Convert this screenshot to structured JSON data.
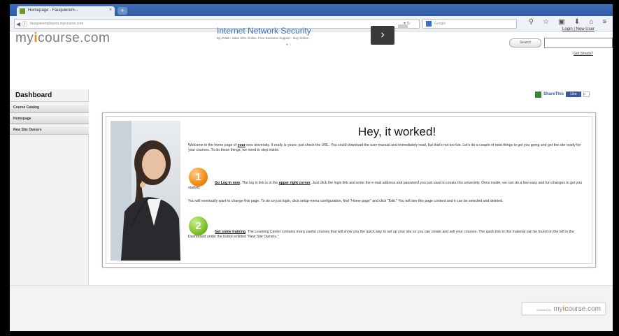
{
  "browser": {
    "tab_title": "Homepage - Fauquierem...",
    "tab_close": "×",
    "tab_new": "+",
    "url": "fauquieremployers.myicourse.com",
    "search_placeholder": "Google",
    "toolbar_icons": [
      "search-icon",
      "star-icon",
      "bookmark-icon",
      "download-icon",
      "home-icon",
      "menu-icon"
    ]
  },
  "header": {
    "logo_prefix": "my",
    "logo_accent": "i",
    "logo_suffix": "course.com",
    "ad": {
      "title": "Internet Network Security",
      "subtitle": "By AV&B - Save 20% Online. Free Business Support - Buy Online",
      "dots": "● ○",
      "arrow": "›"
    },
    "login": "Login",
    "new_user": "New User",
    "search_button": "Search",
    "got_smarts": "Got Smarts?"
  },
  "sidebar": {
    "title": "Dashboard",
    "items": [
      {
        "label": "Course Catalog"
      },
      {
        "label": "Homepage"
      },
      {
        "label": "New Site Owners"
      }
    ]
  },
  "share": {
    "label": "ShareThis",
    "like": "Like",
    "count": "0"
  },
  "main": {
    "heading": "Hey, it worked!",
    "intro_a": "Welcome to the home page of ",
    "intro_b": "your",
    "intro_c": " new university. It really is yours: just check the URL. You could download the user manual and immediately read, but that's not too fun. Let's do a couple of neat things to get you going and get the site ready for your courses. To do these things, we need to step inside.",
    "step1_badge": "1",
    "step1_title": "Go Log in now",
    "step1_a": ". The log in link is in the ",
    "step1_b": "upper right corner",
    "step1_c": ". Just click the login link and enter the e-mail address and password you just used to create this university. Once inside, we can do a few easy and fun changes to get you started.",
    "mid": "You will eventually want to change this page. To do so just login, click setup-menu configuration, find \"Home page\" and click \"Edit.\" You will see this page content and it can be selected and deleted.",
    "step2_badge": "2",
    "step2_title": "Get some training",
    "step2_text": ". The Learning Center contains many useful courses that will show you the quick way to set up your site so you can create and sell your courses. The quick link to this material can be found on the left in the Dashboard under the button entitled \"New Site Owners.\""
  },
  "footer": {
    "powered": "powered by",
    "brand_prefix": "my",
    "brand_accent": "i",
    "brand_suffix": "course.com"
  }
}
